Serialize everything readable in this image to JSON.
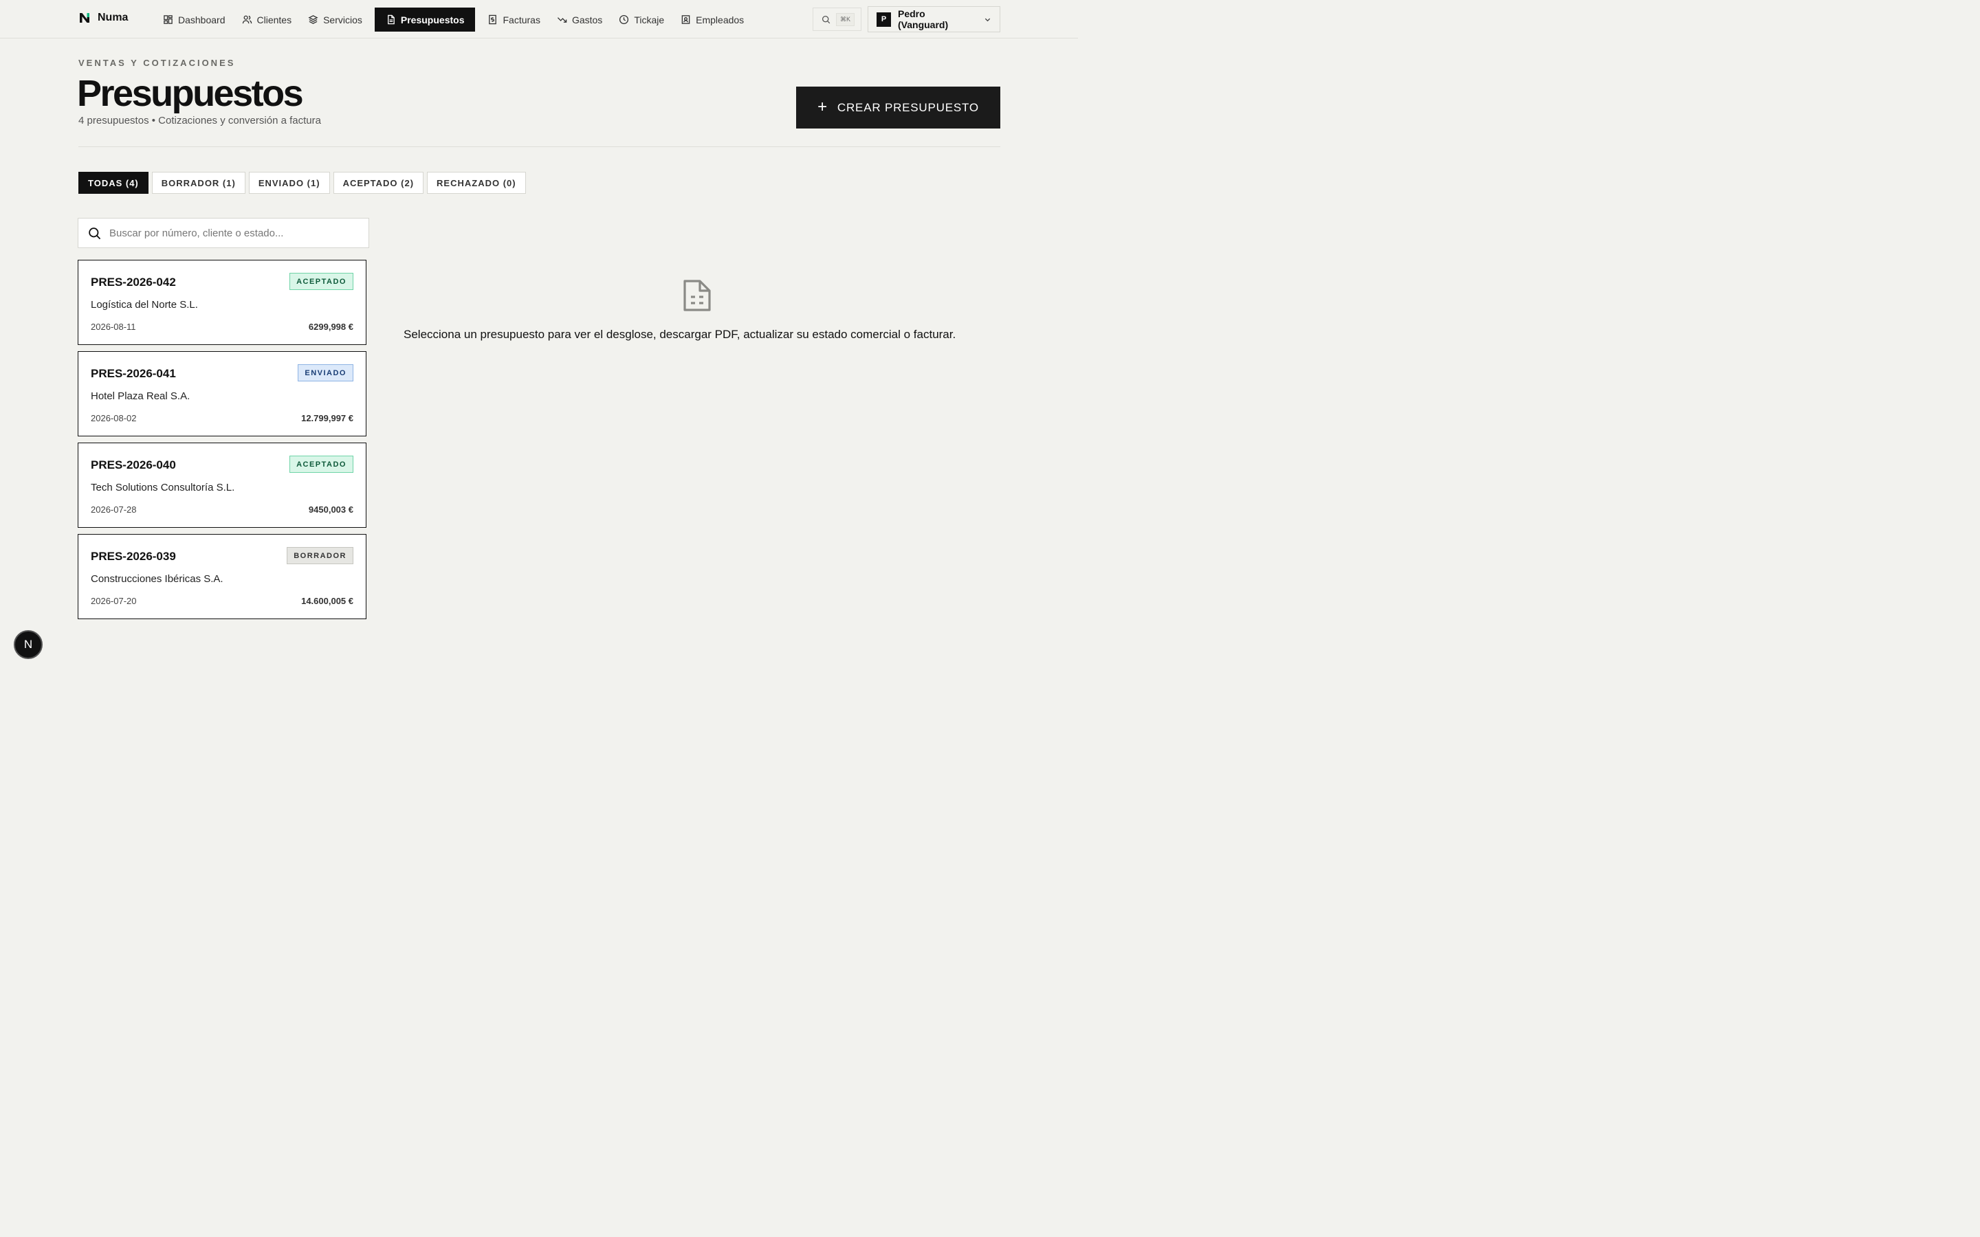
{
  "app": {
    "name": "Numa"
  },
  "nav": {
    "items": [
      {
        "label": "Dashboard",
        "icon": "dashboard-icon"
      },
      {
        "label": "Clientes",
        "icon": "users-icon"
      },
      {
        "label": "Servicios",
        "icon": "layers-icon"
      },
      {
        "label": "Presupuestos",
        "icon": "document-icon",
        "active": true
      },
      {
        "label": "Facturas",
        "icon": "invoice-icon"
      },
      {
        "label": "Gastos",
        "icon": "trend-down-icon"
      },
      {
        "label": "Tickaje",
        "icon": "clock-icon"
      },
      {
        "label": "Empleados",
        "icon": "id-badge-icon"
      }
    ],
    "search_shortcut": "⌘K"
  },
  "user": {
    "initial": "P",
    "name": "Pedro (Vanguard)"
  },
  "header": {
    "eyebrow": "VENTAS Y COTIZACIONES",
    "title": "Presupuestos",
    "subtitle": "4 presupuestos • Cotizaciones y conversión a factura",
    "create_label": "CREAR PRESUPUESTO"
  },
  "tabs": [
    {
      "label": "TODAS (4)",
      "active": true
    },
    {
      "label": "BORRADOR (1)"
    },
    {
      "label": "ENVIADO (1)"
    },
    {
      "label": "ACEPTADO (2)"
    },
    {
      "label": "RECHAZADO (0)"
    }
  ],
  "search": {
    "placeholder": "Buscar por número, cliente o estado...",
    "value": ""
  },
  "quotes": [
    {
      "number": "PRES-2026-042",
      "status": "ACEPTADO",
      "status_key": "aceptado",
      "client": "Logística del Norte S.L.",
      "date": "2026-08-11",
      "amount": "6299,998 €"
    },
    {
      "number": "PRES-2026-041",
      "status": "ENVIADO",
      "status_key": "enviado",
      "client": "Hotel Plaza Real S.A.",
      "date": "2026-08-02",
      "amount": "12.799,997 €"
    },
    {
      "number": "PRES-2026-040",
      "status": "ACEPTADO",
      "status_key": "aceptado",
      "client": "Tech Solutions Consultoría S.L.",
      "date": "2026-07-28",
      "amount": "9450,003 €"
    },
    {
      "number": "PRES-2026-039",
      "status": "BORRADOR",
      "status_key": "borrador",
      "client": "Construcciones Ibéricas S.A.",
      "date": "2026-07-20",
      "amount": "14.600,005 €"
    }
  ],
  "detail": {
    "empty_icon": "document-list-icon",
    "empty_text": "Selecciona un presupuesto para ver el desglose, descargar PDF, actualizar su estado comercial o facturar."
  },
  "dev_badge": {
    "label": "N"
  },
  "colors": {
    "background": "#f2f2ee",
    "primary": "#111111",
    "brand_accent": "#10b981",
    "aceptado_bg": "#d9f6e8",
    "enviado_bg": "#dce9fa",
    "borrador_bg": "#e6e6e2"
  }
}
